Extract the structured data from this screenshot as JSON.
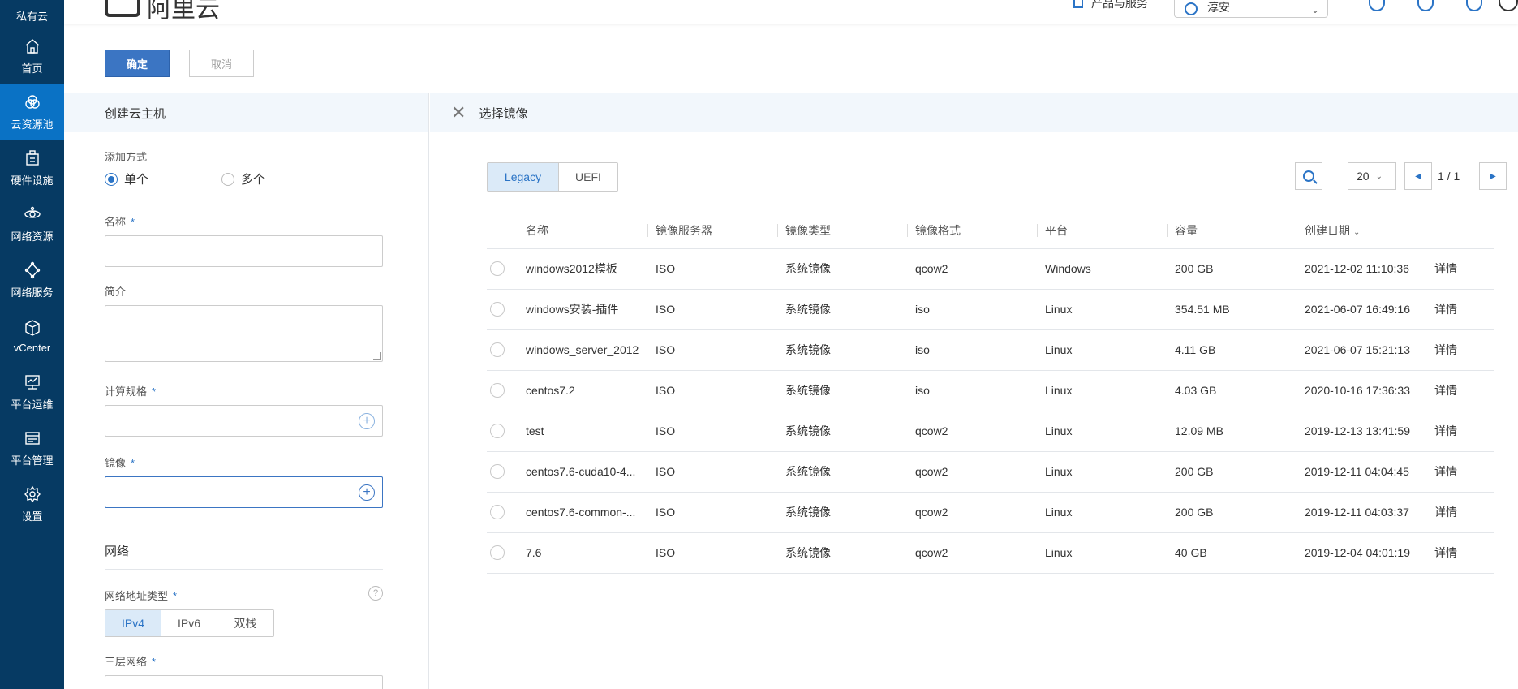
{
  "sidebar": {
    "top_label": "私有云",
    "items": [
      {
        "label": "首页",
        "icon": "home-icon"
      },
      {
        "label": "云资源池",
        "icon": "cloud-pool-icon",
        "active": true
      },
      {
        "label": "硬件设施",
        "icon": "hardware-icon"
      },
      {
        "label": "网络资源",
        "icon": "network-resource-icon"
      },
      {
        "label": "网络服务",
        "icon": "network-service-icon"
      },
      {
        "label": "vCenter",
        "icon": "vcenter-cube-icon"
      },
      {
        "label": "平台运维",
        "icon": "monitor-icon"
      },
      {
        "label": "平台管理",
        "icon": "management-icon"
      },
      {
        "label": "设置",
        "icon": "gear-icon"
      }
    ]
  },
  "header": {
    "logo_text": "阿里云",
    "products_label": "产品与服务",
    "region_label": "淳安"
  },
  "actions": {
    "confirm": "确定",
    "cancel": "取消"
  },
  "left_panel": {
    "title": "创建云主机",
    "add_mode_label": "添加方式",
    "add_mode_options": [
      "单个",
      "多个"
    ],
    "add_mode_selected": "单个",
    "name_label": "名称",
    "desc_label": "简介",
    "spec_label": "计算规格",
    "image_label": "镜像",
    "required_mark": "*",
    "network_section": "网络",
    "addr_type_label": "网络地址类型",
    "addr_type_options": [
      "IPv4",
      "IPv6",
      "双栈"
    ],
    "addr_type_selected": "IPv4",
    "l3_network_label": "三层网络",
    "help_mark": "?"
  },
  "right_panel": {
    "title": "选择镜像",
    "boot_modes": [
      "Legacy",
      "UEFI"
    ],
    "boot_selected": "Legacy",
    "page_size": "20",
    "page_info": "1 / 1",
    "columns": [
      "名称",
      "镜像服务器",
      "镜像类型",
      "镜像格式",
      "平台",
      "容量",
      "创建日期"
    ],
    "detail_label": "详情",
    "rows": [
      {
        "name": "windows2012模板",
        "server": "ISO",
        "type": "系统镜像",
        "format": "qcow2",
        "platform": "Windows",
        "size": "200 GB",
        "created": "2021-12-02 11:10:36"
      },
      {
        "name": "windows安装-插件",
        "server": "ISO",
        "type": "系统镜像",
        "format": "iso",
        "platform": "Linux",
        "size": "354.51 MB",
        "created": "2021-06-07 16:49:16"
      },
      {
        "name": "windows_server_2012",
        "server": "ISO",
        "type": "系统镜像",
        "format": "iso",
        "platform": "Linux",
        "size": "4.11 GB",
        "created": "2021-06-07 15:21:13"
      },
      {
        "name": "centos7.2",
        "server": "ISO",
        "type": "系统镜像",
        "format": "iso",
        "platform": "Linux",
        "size": "4.03 GB",
        "created": "2020-10-16 17:36:33"
      },
      {
        "name": "test",
        "server": "ISO",
        "type": "系统镜像",
        "format": "qcow2",
        "platform": "Linux",
        "size": "12.09 MB",
        "created": "2019-12-13 13:41:59"
      },
      {
        "name": "centos7.6-cuda10-4...",
        "server": "ISO",
        "type": "系统镜像",
        "format": "qcow2",
        "platform": "Linux",
        "size": "200 GB",
        "created": "2019-12-11 04:04:45"
      },
      {
        "name": "centos7.6-common-...",
        "server": "ISO",
        "type": "系统镜像",
        "format": "qcow2",
        "platform": "Linux",
        "size": "200 GB",
        "created": "2019-12-11 04:03:37"
      },
      {
        "name": "7.6",
        "server": "ISO",
        "type": "系统镜像",
        "format": "qcow2",
        "platform": "Linux",
        "size": "40 GB",
        "created": "2019-12-04 04:01:19"
      }
    ]
  },
  "colors": {
    "sidebar_bg": "#063a63",
    "sidebar_active": "#0a72c5",
    "primary": "#3b75c3",
    "link": "#2b74c6"
  }
}
